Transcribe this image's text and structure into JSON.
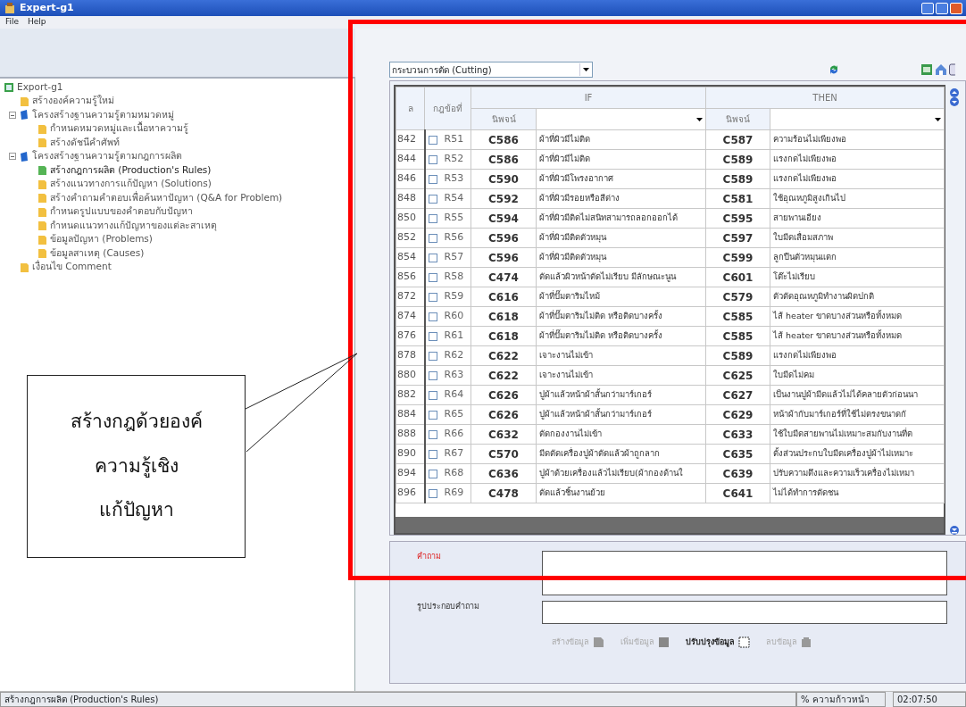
{
  "window": {
    "title": "Expert-g1"
  },
  "menu": [
    "File",
    "Help"
  ],
  "tree": {
    "label": "Export-g1",
    "children": [
      {
        "label": "สร้างองค์ความรู้ใหม่",
        "selected": false
      },
      {
        "label": "โครงสร้างฐานความรู้ตามหมวดหมู่",
        "selected": false,
        "expanded": true,
        "children": [
          {
            "label": "กำหนดหมวดหมู่และเนื้อหาความรู้",
            "selected": false
          },
          {
            "label": "สร้างดัชนีคำศัพท์",
            "selected": false
          }
        ]
      },
      {
        "label": "โครงสร้างฐานความรู้ตามกฎการผลิต",
        "selected": false,
        "expanded": true,
        "children": [
          {
            "label": "สร้างกฎการผลิต (Production's Rules)",
            "selected": true
          },
          {
            "label": "สร้างแนวทางการแก้ปัญหา (Solutions)",
            "selected": false
          },
          {
            "label": "สร้างคำถามคำตอบเพื่อค้นหาปัญหา (Q&A for Problem)",
            "selected": false
          },
          {
            "label": "กำหนดรูปแบบของคำตอบกับปัญหา",
            "selected": false
          },
          {
            "label": "กำหนดแนวทางแก้ปัญหาของแต่ละสาเหตุ",
            "selected": false
          },
          {
            "label": "ข้อมูลปัญหา (Problems)",
            "selected": false
          },
          {
            "label": "ข้อมูลสาเหตุ (Causes)",
            "selected": false
          }
        ]
      },
      {
        "label": "เงื่อนไข Comment",
        "selected": false
      }
    ]
  },
  "process_select": {
    "value": "กระบวนการตัด (Cutting)"
  },
  "table": {
    "columns": [
      "ล",
      "กฎข้อที่"
    ],
    "groups": [
      "IF",
      "THEN"
    ],
    "sub_header": [
      "นิพจน์",
      "นิพจน์"
    ],
    "rows": [
      {
        "index": "842",
        "checked": false,
        "rule": "R51",
        "if_code": "C586",
        "if_text": "ผ้าที่ผิวมีไม่ติด",
        "then_code": "C587",
        "then_text": "ความร้อนไม่เพียงพอ"
      },
      {
        "index": "844",
        "checked": false,
        "rule": "R52",
        "if_code": "C586",
        "if_text": "ผ้าที่ผิวมีไม่ติด",
        "then_code": "C589",
        "then_text": "แรงกดไม่เพียงพอ"
      },
      {
        "index": "846",
        "checked": false,
        "rule": "R53",
        "if_code": "C590",
        "if_text": "ผ้าที่ผิวมีโพรงอากาศ",
        "then_code": "C589",
        "then_text": "แรงกดไม่เพียงพอ"
      },
      {
        "index": "848",
        "checked": false,
        "rule": "R54",
        "if_code": "C592",
        "if_text": "ผ้าที่ผิวมีรอยหรือสีด่าง",
        "then_code": "C581",
        "then_text": "ใช้อุณหภูมิสูงเกินไป"
      },
      {
        "index": "850",
        "checked": false,
        "rule": "R55",
        "if_code": "C594",
        "if_text": "ผ้าที่ผิวมีติดไม่สนิทสามารถลอกออกได้",
        "then_code": "C595",
        "then_text": "สายพานเอียง"
      },
      {
        "index": "852",
        "checked": false,
        "rule": "R56",
        "if_code": "C596",
        "if_text": "ผ้าที่ผิวมีติดตัวหมุน",
        "then_code": "C597",
        "then_text": "ใบมีดเสื่อมสภาพ"
      },
      {
        "index": "854",
        "checked": false,
        "rule": "R57",
        "if_code": "C596",
        "if_text": "ผ้าที่ผิวมีติดตัวหมุน",
        "then_code": "C599",
        "then_text": "ลูกปืนตัวหมุนแตก"
      },
      {
        "index": "856",
        "checked": false,
        "rule": "R58",
        "if_code": "C474",
        "if_text": "ตัดแล้วผิวหน้าตัดไม่เรียบ มีลักษณะนูน",
        "then_code": "C601",
        "then_text": "โต๊ะไม่เรียบ"
      },
      {
        "index": "872",
        "checked": false,
        "rule": "R59",
        "if_code": "C616",
        "if_text": "ผ้าที่ปั๊มตาริมไหม้",
        "then_code": "C579",
        "then_text": "ตัวตัดอุณหภูมิทำงานผิดปกติ"
      },
      {
        "index": "874",
        "checked": false,
        "rule": "R60",
        "if_code": "C618",
        "if_text": "ผ้าที่ปั๊มตาริมไม่ติด หรือติดบางครั้ง",
        "then_code": "C585",
        "then_text": "ไส้ heater ขาดบางส่วนหรือทั้งหมด"
      },
      {
        "index": "876",
        "checked": false,
        "rule": "R61",
        "if_code": "C618",
        "if_text": "ผ้าที่ปั๊มตาริมไม่ติด หรือติดบางครั้ง",
        "then_code": "C585",
        "then_text": "ไส้ heater ขาดบางส่วนหรือทั้งหมด"
      },
      {
        "index": "878",
        "checked": false,
        "rule": "R62",
        "if_code": "C622",
        "if_text": "เจาะงานไม่เข้า",
        "then_code": "C589",
        "then_text": "แรงกดไม่เพียงพอ"
      },
      {
        "index": "880",
        "checked": false,
        "rule": "R63",
        "if_code": "C622",
        "if_text": "เจาะงานไม่เข้า",
        "then_code": "C625",
        "then_text": "ใบมีดไม่คม"
      },
      {
        "index": "882",
        "checked": false,
        "rule": "R64",
        "if_code": "C626",
        "if_text": "ปูผ้าแล้วหน้าผ้าสั้นกว่ามาร์เกอร์",
        "then_code": "C627",
        "then_text": "เป็นงานปูผ้ามีดแล้วไม่ได้คลายตัวก่อนนา"
      },
      {
        "index": "884",
        "checked": false,
        "rule": "R65",
        "if_code": "C626",
        "if_text": "ปูผ้าแล้วหน้าผ้าสั้นกว่ามาร์เกอร์",
        "then_code": "C629",
        "then_text": "หน้าผ้ากับมาร์เกอร์ที่ใช้ไม่ตรงขนาดกั"
      },
      {
        "index": "888",
        "checked": false,
        "rule": "R66",
        "if_code": "C632",
        "if_text": "ตัดกองงานไม่เข้า",
        "then_code": "C633",
        "then_text": "ใช้ใบมีดสายพานไม่เหมาะสมกับงานที่ต"
      },
      {
        "index": "890",
        "checked": false,
        "rule": "R67",
        "if_code": "C570",
        "if_text": "มีดตัดเครื่องปูผ้าตัดแล้วผ้าถูกลาก",
        "then_code": "C635",
        "then_text": "ตั้งส่วนประกบใบมีดเครื่องปูผ้าไม่เหมาะ"
      },
      {
        "index": "894",
        "checked": false,
        "rule": "R68",
        "if_code": "C636",
        "if_text": "ปูผ้าด้วยเครื่องแล้วไม่เรียบ(ผ้ากองด้านใ",
        "then_code": "C639",
        "then_text": "ปรับความตึงและความเร็วเครื่องไม่เหมา"
      },
      {
        "index": "896",
        "checked": false,
        "rule": "R69",
        "if_code": "C478",
        "if_text": "ตัดแล้วชิ้นงานย้วย",
        "then_code": "C641",
        "then_text": "ไม่ได้ทำการตัดชน"
      }
    ]
  },
  "form": {
    "question_label": "คำถาม",
    "image_label": "รูปประกอบคำถาม"
  },
  "actions": [
    {
      "label": "สร้างข้อมูล",
      "disabled": true
    },
    {
      "label": "เพิ่มข้อมูล",
      "disabled": true
    },
    {
      "label": "ปรับปรุงข้อมูล",
      "disabled": false
    },
    {
      "label": "ลบข้อมูล",
      "disabled": true
    }
  ],
  "status_bar": {
    "message": "สร้างกฎการผลิต (Production's Rules)",
    "progress": "% ความก้าวหน้า",
    "time": "02:07:50"
  },
  "callout": {
    "lines": [
      "สร้างกฎด้วยองค์",
      "ความรู้เชิง",
      "แก้ปัญหา"
    ]
  }
}
